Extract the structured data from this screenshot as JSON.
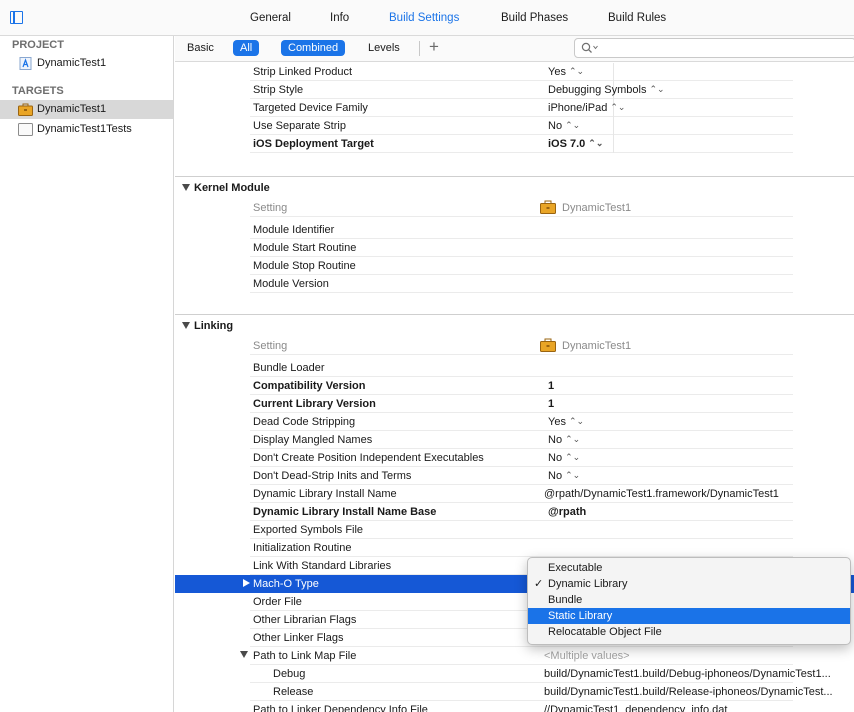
{
  "tabs": [
    {
      "label": "General",
      "active": false
    },
    {
      "label": "Info",
      "active": false
    },
    {
      "label": "Build Settings",
      "active": true
    },
    {
      "label": "Build Phases",
      "active": false
    },
    {
      "label": "Build Rules",
      "active": false
    }
  ],
  "navigator": {
    "project_header": "PROJECT",
    "project_item": "DynamicTest1",
    "targets_header": "TARGETS",
    "targets": [
      "DynamicTest1",
      "DynamicTest1Tests"
    ]
  },
  "filters": {
    "basic": "Basic",
    "all": "All",
    "combined": "Combined",
    "levels": "Levels",
    "add": "+",
    "search_placeholder": ""
  },
  "target_column": "DynamicTest1",
  "setting_header": "Setting",
  "strip_rows": [
    {
      "name": "Strip Linked Product",
      "value": "Yes",
      "chev": true,
      "bold": false
    },
    {
      "name": "Strip Style",
      "value": "Debugging Symbols",
      "chev": true,
      "bold": false
    },
    {
      "name": "Targeted Device Family",
      "value": "iPhone/iPad",
      "chev": true,
      "bold": false
    },
    {
      "name": "Use Separate Strip",
      "value": "No",
      "chev": true,
      "bold": false
    },
    {
      "name": "iOS Deployment Target",
      "value": "iOS 7.0",
      "chev": true,
      "bold": true
    }
  ],
  "kernel_section": {
    "title": "Kernel Module",
    "rows": [
      "Module Identifier",
      "Module Start Routine",
      "Module Stop Routine",
      "Module Version"
    ]
  },
  "linking_section": {
    "title": "Linking",
    "rows": [
      {
        "name": "Bundle Loader",
        "value": "",
        "chev": false,
        "bold": false
      },
      {
        "name": "Compatibility Version",
        "value": "1",
        "chev": false,
        "bold": true
      },
      {
        "name": "Current Library Version",
        "value": "1",
        "chev": false,
        "bold": true
      },
      {
        "name": "Dead Code Stripping",
        "value": "Yes",
        "chev": true,
        "bold": false
      },
      {
        "name": "Display Mangled Names",
        "value": "No",
        "chev": true,
        "bold": false
      },
      {
        "name": "Don't Create Position Independent Executables",
        "value": "No",
        "chev": true,
        "bold": false
      },
      {
        "name": "Don't Dead-Strip Inits and Terms",
        "value": "No",
        "chev": true,
        "bold": false
      },
      {
        "name": "Dynamic Library Install Name",
        "value": "@rpath/DynamicTest1.framework/DynamicTest1",
        "chev": false,
        "bold": false
      },
      {
        "name": "Dynamic Library Install Name Base",
        "value": "@rpath",
        "chev": false,
        "bold": true
      },
      {
        "name": "Exported Symbols File",
        "value": "",
        "chev": false,
        "bold": false
      },
      {
        "name": "Initialization Routine",
        "value": "",
        "chev": false,
        "bold": false
      },
      {
        "name": "Link With Standard Libraries",
        "value": "",
        "chev": false,
        "bold": false
      }
    ],
    "selected_row": "Mach-O Type",
    "after_rows": [
      "Order File",
      "Other Librarian Flags",
      "Other Linker Flags"
    ],
    "path_link_map": {
      "name": "Path to Link Map File",
      "value": "<Multiple values>"
    },
    "sub_rows": [
      {
        "name": "Debug",
        "value": "build/DynamicTest1.build/Debug-iphoneos/DynamicTest1..."
      },
      {
        "name": "Release",
        "value": "build/DynamicTest1.build/Release-iphoneos/DynamicTest..."
      }
    ],
    "last_row": {
      "name": "Path to Linker Dependency Info File",
      "value": "//DynamicTest1_dependency_info.dat"
    }
  },
  "popup": {
    "options": [
      "Executable",
      "Dynamic Library",
      "Bundle",
      "Static Library",
      "Relocatable Object File"
    ],
    "checked": "Dynamic Library",
    "highlighted": "Static Library",
    "checkmark": "✓"
  },
  "colors": {
    "accent": "#1b74e8",
    "selection": "#1558d6"
  }
}
